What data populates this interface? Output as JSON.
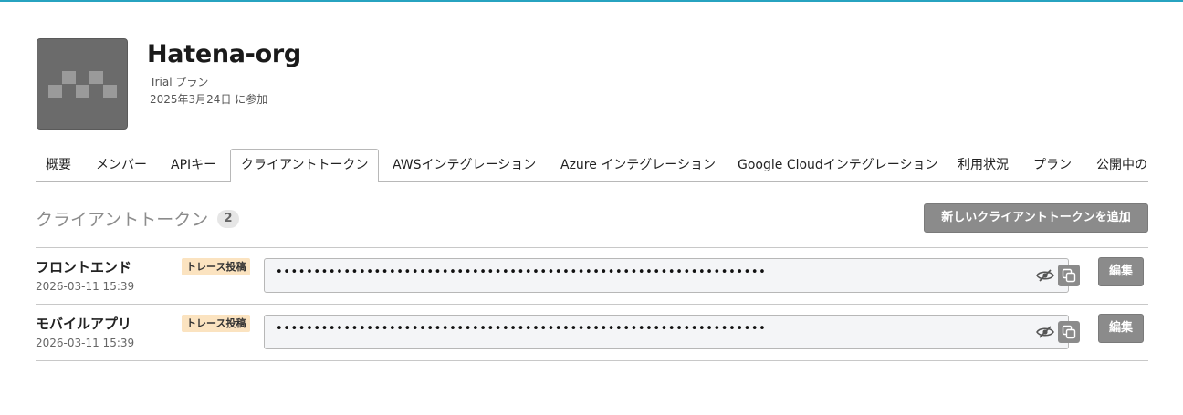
{
  "org": {
    "name": "Hatena-org",
    "plan": "Trial プラン",
    "joined": "2025年3月24日 に参加",
    "avatar_icon": "org-pattern-avatar"
  },
  "tabs": [
    {
      "label": "概要",
      "active": false
    },
    {
      "label": "メンバー",
      "active": false
    },
    {
      "label": "APIキー",
      "active": false
    },
    {
      "label": "クライアントトークン",
      "active": true
    },
    {
      "label": "AWSインテグレーション",
      "active": false
    },
    {
      "label": "Azure インテグレーション",
      "active": false
    },
    {
      "label": "Google Cloudインテグレーション",
      "active": false
    },
    {
      "label": "利用状況",
      "active": false
    },
    {
      "label": "プラン",
      "active": false
    },
    {
      "label": "公開中の",
      "active": false
    }
  ],
  "section": {
    "title": "クライアントトークン",
    "count": "2",
    "add_button": "新しいクライアントトークンを追加"
  },
  "tokens": [
    {
      "name": "フロントエンド",
      "date": "2026-03-11 15:39",
      "scope": "トレース投稿",
      "masked_value": "•••••••••••••••••••••••••••••••••••••••••••••••••••••••••••••••••",
      "edit_label": "編集"
    },
    {
      "name": "モバイルアプリ",
      "date": "2026-03-11 15:39",
      "scope": "トレース投稿",
      "masked_value": "•••••••••••••••••••••••••••••••••••••••••••••••••••••••••••••••••",
      "edit_label": "編集"
    }
  ],
  "colors": {
    "accent_line": "#27a3c0",
    "button_gray": "#8b8b8b",
    "scope_badge": "#fbe3c0"
  }
}
